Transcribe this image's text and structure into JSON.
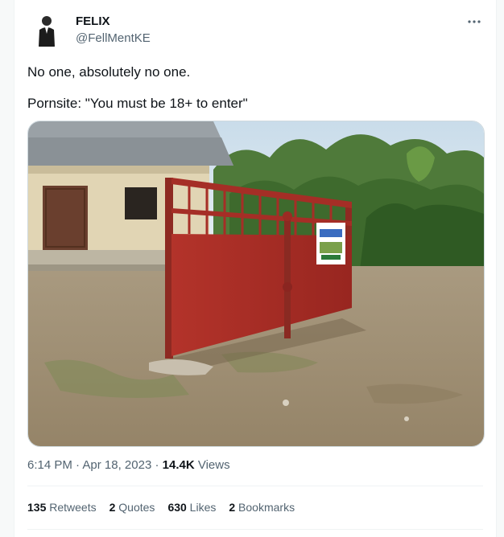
{
  "tweet": {
    "author": {
      "name": "FELIX",
      "handle": "@FellMentKE"
    },
    "text_lines": [
      "No one, absolutely no one.",
      "Pornsite: \"You must be 18+ to enter\""
    ],
    "image_icon": "photo-red-gate-standalone",
    "meta": {
      "time": "6:14 PM",
      "sep": " · ",
      "date": "Apr 18, 2023",
      "views_count": "14.4K",
      "views_label": " Views"
    },
    "stats": [
      {
        "num": "135",
        "label": " Retweets"
      },
      {
        "num": "2",
        "label": " Quotes"
      },
      {
        "num": "630",
        "label": " Likes"
      },
      {
        "num": "2",
        "label": " Bookmarks"
      }
    ],
    "more_icon": "more-horizontal-icon"
  },
  "colors": {
    "secondary_text": "#536471",
    "primary_text": "#0f1419",
    "border": "#eff3f4"
  }
}
